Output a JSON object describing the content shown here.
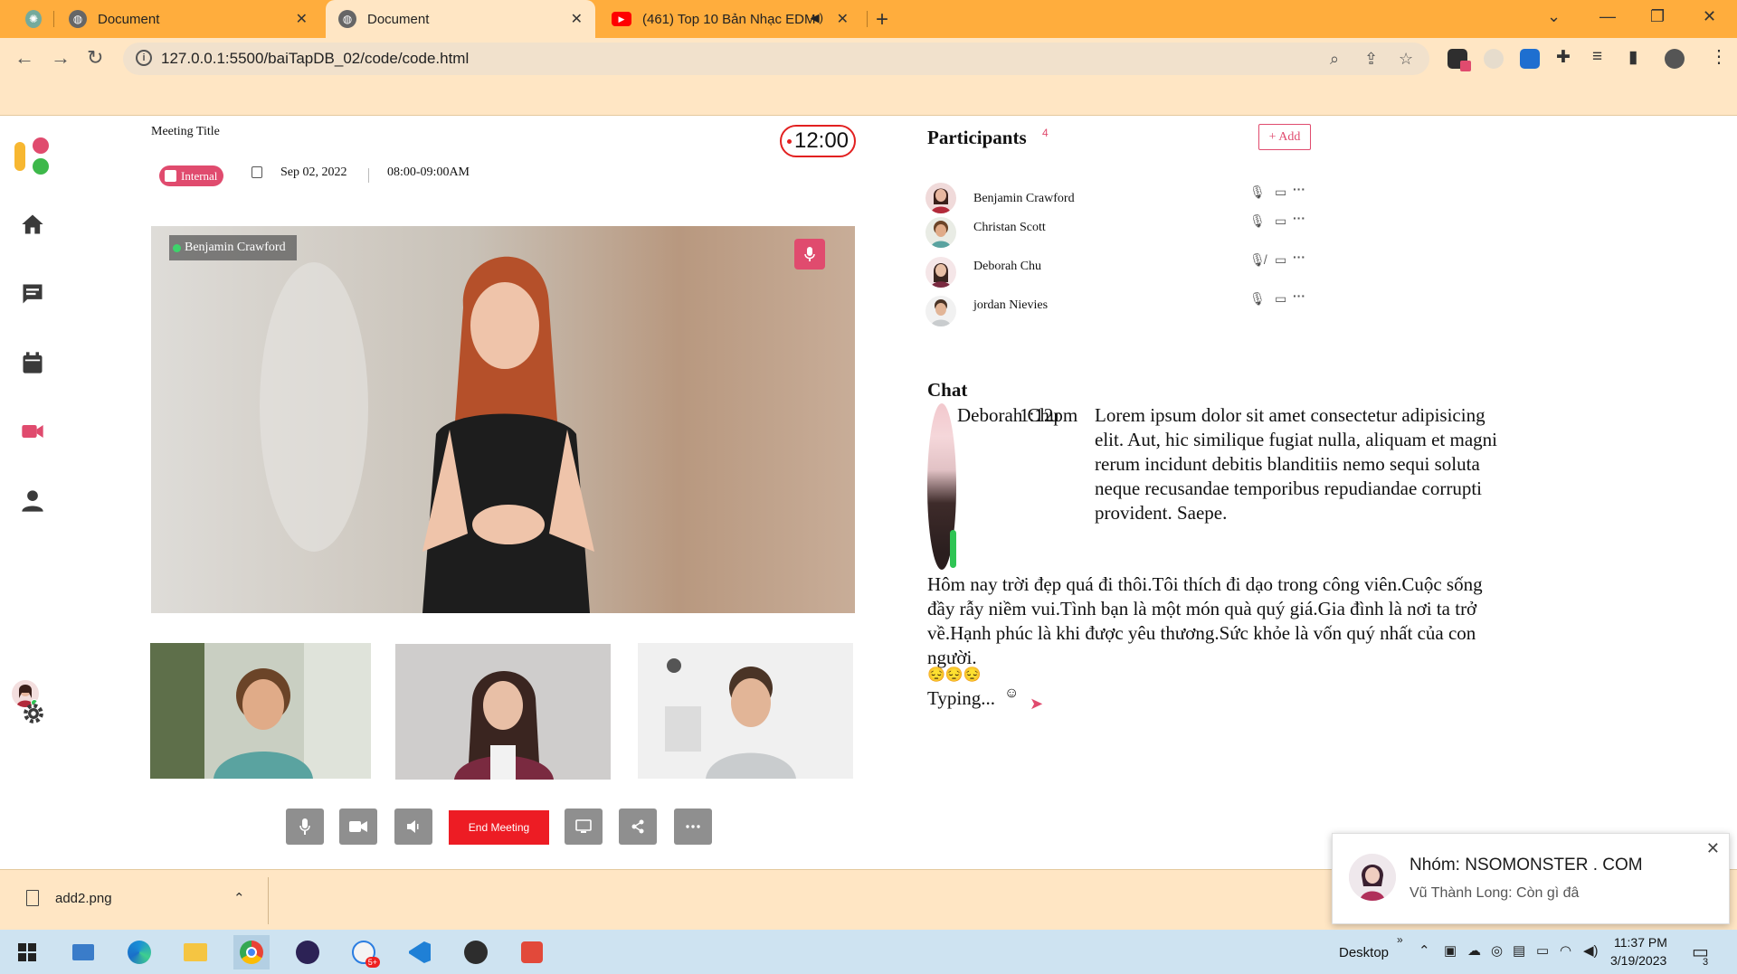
{
  "browser": {
    "tabs": [
      {
        "title": "",
        "icon": "chatgpt-icon"
      },
      {
        "title": "Document",
        "icon": "globe-icon"
      },
      {
        "title": "Document",
        "icon": "globe-icon"
      },
      {
        "title": "(461) Top 10 Bản Nhạc EDM",
        "icon": "youtube-icon"
      }
    ],
    "url": "127.0.0.1:5500/baiTapDB_02/code/code.html"
  },
  "meeting": {
    "title": "Meeting Title",
    "timer": "12:00",
    "badge": "Internal",
    "date": "Sep 02, 2022",
    "time_range": "08:00-09:00AM",
    "main_speaker": "Benjamin Crawford",
    "end_button": "End Meeting"
  },
  "participants": {
    "title": "Participants",
    "count": "4",
    "add_label": "+ Add",
    "list": [
      {
        "name": "Benjamin Crawford",
        "mic": "on"
      },
      {
        "name": "Christan Scott",
        "mic": "on"
      },
      {
        "name": "Deborah Chu",
        "mic": "muted"
      },
      {
        "name": "jordan Nievies",
        "mic": "on"
      }
    ]
  },
  "chat": {
    "title": "Chat",
    "sender": "Deborah Chu",
    "time": "1:12pm",
    "message": "Lorem ipsum dolor sit amet consectetur adipisicing elit. Aut, hic similique fugiat nulla, aliquam et magni rerum incidunt debitis blanditiis nemo sequi soluta neque recusandae temporibus repudiandae corrupti provident. Saepe.",
    "text": "Hôm nay trời đẹp quá đi thôi.Tôi thích đi dạo trong công viên.Cuộc sống đầy rẫy niềm vui.Tình bạn là một món quà quý giá.Gia đình là nơi ta trở về.Hạnh phúc là khi được yêu thương.Sức khỏe là vốn quý nhất của con người.",
    "emoji": "😔😔😔",
    "typing": "Typing...",
    "typing_emoji": "☺"
  },
  "download": {
    "file": "add2.png"
  },
  "notification": {
    "title": "Nhóm: NSOMONSTER . COM",
    "body": "Vũ Thành Long: Còn gì đâ"
  },
  "taskbar": {
    "desktop_label": "Desktop",
    "time": "11:37 PM",
    "date": "3/19/2023",
    "notif_count": "3",
    "zalo_badge": "5+"
  },
  "colors": {
    "tabbar": "#ffad3d",
    "chrome": "#ffe6c4",
    "accent": "#e04b6e",
    "end_red": "#ed1c24"
  }
}
